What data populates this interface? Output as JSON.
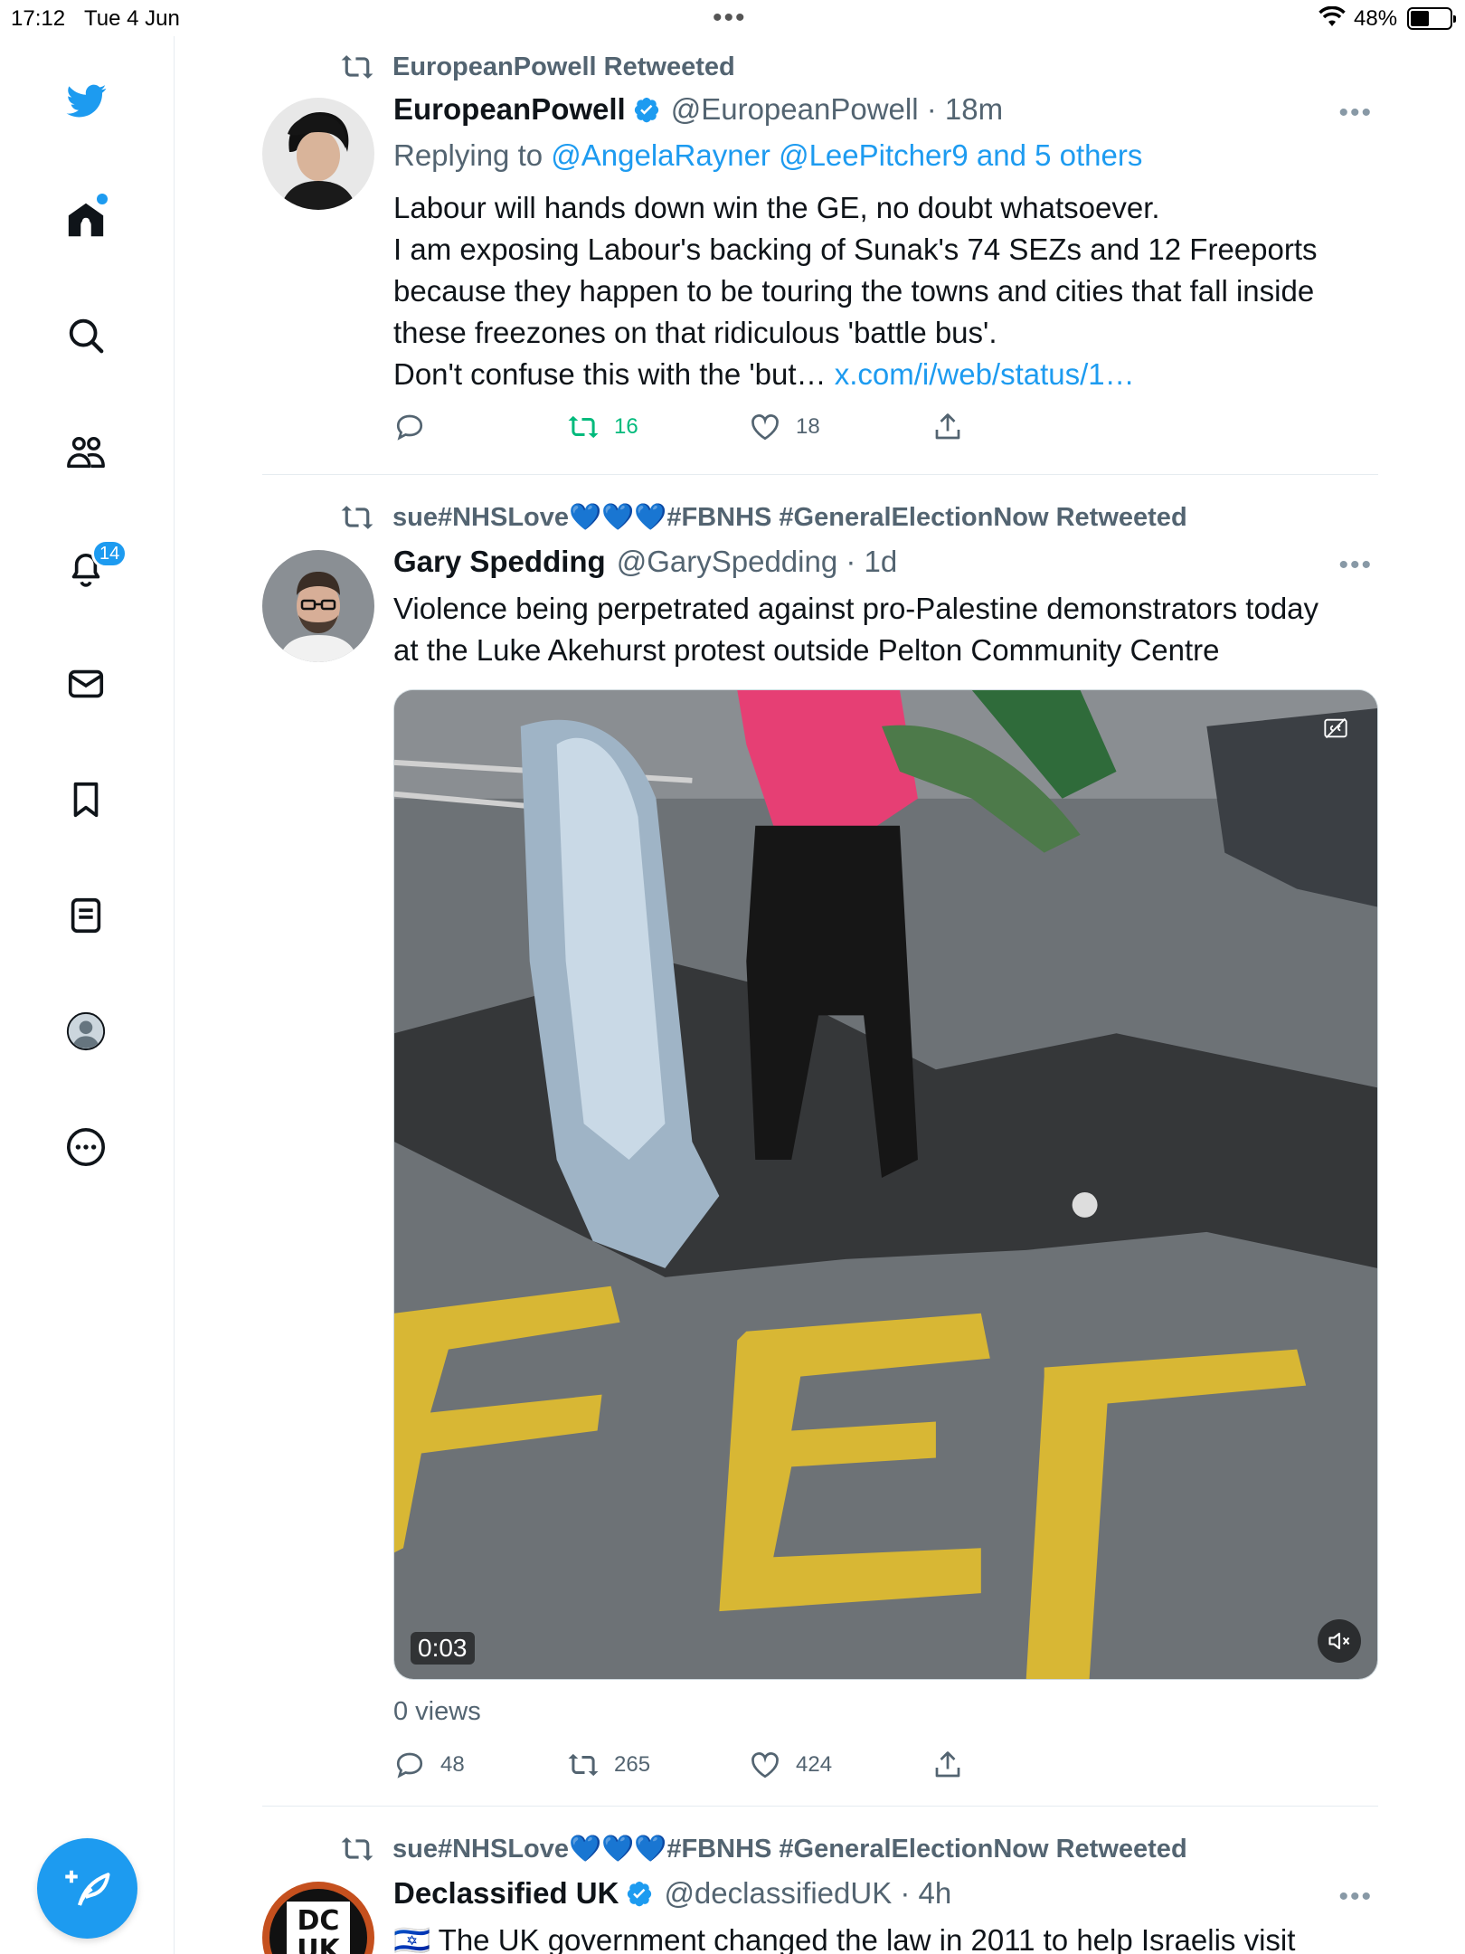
{
  "status_bar": {
    "time": "17:12",
    "date": "Tue 4 Jun",
    "battery": "48%"
  },
  "sidebar": {
    "notifications_badge": "14",
    "items": [
      "twitter-logo",
      "home-icon",
      "search-icon",
      "communities-icon",
      "notifications-icon",
      "messages-icon",
      "bookmarks-icon",
      "lists-icon",
      "profile-icon",
      "more-icon"
    ],
    "compose_icon": "compose-icon"
  },
  "colors": {
    "accent": "#1d9bf0",
    "secondary_text": "#536471",
    "retweet_green": "#00ba7c"
  },
  "tweets": [
    {
      "retweeted_by": "EuropeanPowell Retweeted",
      "name": "EuropeanPowell",
      "verified": true,
      "handle": "@EuropeanPowell · 18m",
      "replying_label": "Replying to",
      "replying_to": "@AngelaRayner @LeePitcher9 and 5 others",
      "lines": [
        "Labour will hands down win the GE, no doubt whatsoever.",
        "I am exposing Labour's backing of Sunak's 74 SEZs and 12 Freeports",
        "because they happen to be touring the  towns and cities that fall inside",
        "these freezones on that ridiculous 'battle bus'.",
        "Don't confuse this with the 'but…"
      ],
      "link": "x.com/i/web/status/1…",
      "replies": "",
      "retweets": "16",
      "likes": "18"
    },
    {
      "retweeted_by": "sue#NHSLove💙💙💙#FBNHS #GeneralElectionNow Retweeted",
      "name": "Gary Spedding",
      "verified": false,
      "handle": "@GarySpedding · 1d",
      "lines": [
        "Violence being perpetrated against pro-Palestine demonstrators today",
        "at the Luke Akehurst protest outside Pelton Community Centre"
      ],
      "video_duration": "0:03",
      "views": "0 views",
      "replies": "48",
      "retweets": "265",
      "likes": "424"
    },
    {
      "retweeted_by": "sue#NHSLove💙💙💙#FBNHS #GeneralElectionNow Retweeted",
      "name": "Declassified UK",
      "verified": true,
      "handle": "@declassifiedUK · 4h",
      "avatar_text": "DC UK",
      "lines": [
        "🇮🇱 The UK government changed the law in 2011 to help Israelis visit"
      ]
    }
  ]
}
